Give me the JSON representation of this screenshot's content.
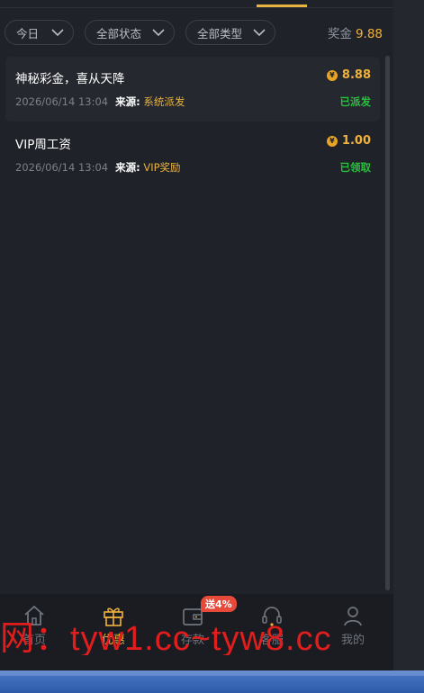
{
  "filters": [
    {
      "label": "今日",
      "icon": "chevron-down-icon"
    },
    {
      "label": "全部状态",
      "icon": "chevron-down-icon"
    },
    {
      "label": "全部类型",
      "icon": "chevron-down-icon"
    }
  ],
  "bonus": {
    "label": "奖金",
    "value": "9.88"
  },
  "records": [
    {
      "title": "神秘彩金，喜从天降",
      "currency_symbol": "¥",
      "amount": "8.88",
      "datetime": "2026/06/14 13:04",
      "source_label": "来源:",
      "source": "系统派发",
      "status": "已派发"
    },
    {
      "title": "VIP周工资",
      "currency_symbol": "¥",
      "amount": "1.00",
      "datetime": "2026/06/14 13:04",
      "source_label": "来源:",
      "source": "VIP奖励",
      "status": "已领取"
    }
  ],
  "nav": [
    {
      "label": "首页",
      "icon": "home-icon"
    },
    {
      "label": "优惠",
      "icon": "gift-icon"
    },
    {
      "label": "存款",
      "icon": "wallet-icon"
    },
    {
      "label": "客服",
      "icon": "headset-icon"
    },
    {
      "label": "我的",
      "icon": "user-icon"
    }
  ],
  "promo_badge": "送4%",
  "watermark": "网：tyw1.cc~tyw8.cc",
  "colors": {
    "accent": "#f0b23a",
    "status_green": "#27c03c",
    "watermark_red": "#e11d1d",
    "badge_red": "#e84a3a"
  }
}
